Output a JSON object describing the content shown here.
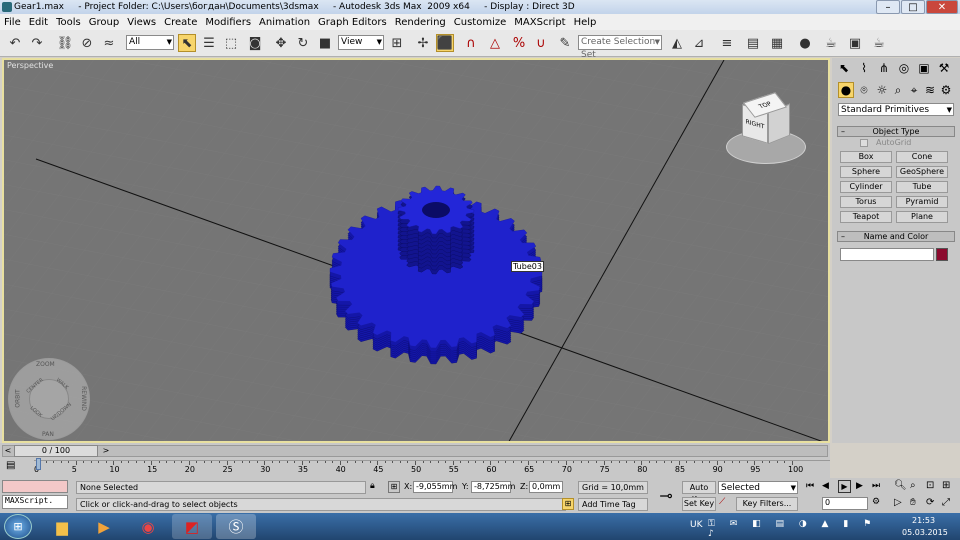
{
  "window": {
    "title": "Gear1.max     - Project Folder: C:\\Users\\богдан\\Documents\\3dsmax     - Autodesk 3ds Max  2009 x64     - Display : Direct 3D",
    "minimize": "–",
    "maximize": "□",
    "close": "✕"
  },
  "menu": [
    "File",
    "Edit",
    "Tools",
    "Group",
    "Views",
    "Create",
    "Modifiers",
    "Animation",
    "Graph Editors",
    "Rendering",
    "Customize",
    "MAXScript",
    "Help"
  ],
  "toolbar": {
    "selection_filter": "All",
    "ref_coord": "View",
    "named_selection_placeholder": "Create Selection Set"
  },
  "viewport": {
    "label": "Perspective",
    "object_tooltip": "Tube03",
    "viewcube_face": "RIGHT",
    "viewcube_top": "TOP",
    "wheel": [
      "ZOOM",
      "ORBIT",
      "REWIND",
      "PAN",
      "CENTER",
      "WALK",
      "LOOK",
      "UP/DOWN"
    ],
    "gear_color": "#1f22cc"
  },
  "command_panel": {
    "category": "Standard Primitives",
    "object_type_header": "Object Type",
    "autogrid": "AutoGrid",
    "buttons": [
      "Box",
      "Cone",
      "Sphere",
      "GeoSphere",
      "Cylinder",
      "Tube",
      "Torus",
      "Pyramid",
      "Teapot",
      "Plane"
    ],
    "name_color_header": "Name and Color",
    "name_value": "",
    "color_swatch": "#8c0a2e"
  },
  "timeline": {
    "frame_display": "0 / 100",
    "ticks": [
      "0",
      "5",
      "10",
      "15",
      "20",
      "25",
      "30",
      "35",
      "40",
      "45",
      "50",
      "55",
      "60",
      "65",
      "70",
      "75",
      "80",
      "85",
      "90",
      "95",
      "100"
    ]
  },
  "status": {
    "maxscript": "MAXScript.",
    "selection": "None Selected",
    "prompt": "Click or click-and-drag to select objects",
    "x_label": "X:",
    "x_value": "-9,055mm",
    "y_label": "Y:",
    "y_value": "-8,725mm",
    "z_label": "Z:",
    "z_value": "0,0mm",
    "grid": "Grid = 10,0mm",
    "add_time_tag": "Add Time Tag",
    "auto_key": "Auto Key",
    "set_key": "Set Key",
    "key_mode": "Selected",
    "key_filters": "Key Filters...",
    "current_frame": "0"
  },
  "taskbar": {
    "lang": "UK",
    "time": "21:53",
    "date": "05.03.2015"
  }
}
